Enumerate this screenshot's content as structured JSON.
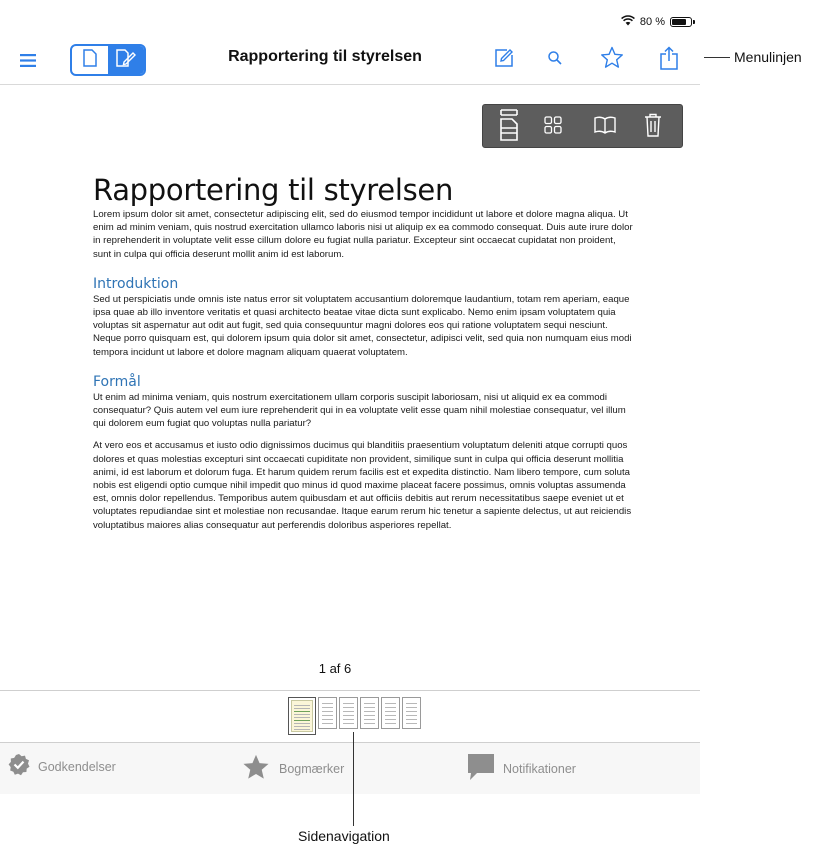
{
  "status_bar": {
    "battery": "80 %",
    "battery_level": 0.8
  },
  "menu_bar": {
    "title": "Rapportering til styrelsen",
    "icons": [
      "hamburger-menu-icon",
      "page-icon",
      "annotate-icon",
      "edit-icon",
      "search-icon",
      "star-icon",
      "share-icon"
    ],
    "accent_color": "#2f7fe8"
  },
  "callouts": {
    "menu": "Menulinjen",
    "page_nav": "Sidenavigation"
  },
  "doc_toolbar": {
    "icons": [
      "page-layout-icon",
      "grid-icon",
      "book-icon",
      "trash-icon"
    ]
  },
  "document": {
    "title": "Rapportering til styrelsen",
    "intro": "Lorem ipsum dolor sit amet, consectetur adipiscing elit, sed do eiusmod tempor incididunt ut labore et dolore magna aliqua. Ut enim ad minim veniam, quis nostrud exercitation ullamco laboris nisi ut aliquip ex ea commodo consequat. Duis aute irure dolor in reprehenderit in voluptate velit esse cillum dolore eu fugiat nulla pariatur. Excepteur sint occaecat cupidatat non proident, sunt in culpa qui officia deserunt mollit anim id est laborum.",
    "section1_heading": "Introduktion",
    "section1_body": "Sed ut perspiciatis unde omnis iste natus error sit voluptatem accusantium doloremque laudantium, totam rem aperiam, eaque ipsa quae ab illo inventore veritatis et quasi architecto beatae vitae dicta sunt explicabo. Nemo enim ipsam voluptatem quia voluptas sit aspernatur aut odit aut fugit, sed quia consequuntur magni dolores eos qui ratione voluptatem sequi nesciunt. Neque porro quisquam est, qui dolorem ipsum quia dolor sit amet, consectetur, adipisci velit, sed quia non numquam eius modi tempora incidunt ut labore et dolore magnam aliquam quaerat voluptatem.",
    "section2_heading": "Formål",
    "section2_body1": "Ut enim ad minima veniam, quis nostrum exercitationem ullam corporis suscipit laboriosam, nisi ut aliquid ex ea commodi consequatur? Quis autem vel eum iure reprehenderit qui in ea voluptate velit esse quam nihil molestiae consequatur, vel illum qui dolorem eum fugiat quo voluptas nulla pariatur?",
    "section2_body2": "At vero eos et accusamus et iusto odio dignissimos ducimus qui blanditiis praesentium voluptatum deleniti atque corrupti quos dolores et quas molestias excepturi sint occaecati cupiditate non provident, similique sunt in culpa qui officia deserunt mollitia animi, id est laborum et dolorum fuga. Et harum quidem rerum facilis est et expedita distinctio. Nam libero tempore, cum soluta nobis est eligendi optio cumque nihil impedit quo minus id quod maxime placeat facere possimus, omnis voluptas assumenda est, omnis dolor repellendus. Temporibus autem quibusdam et aut officiis debitis aut rerum necessitatibus saepe eveniet ut et voluptates repudiandae sint et molestiae non recusandae. Itaque earum rerum hic tenetur a sapiente delectus, ut aut reiciendis voluptatibus maiores alias consequatur aut perferendis doloribus asperiores repellat."
  },
  "page_indicator": "1 af 6",
  "thumbnails": {
    "count": 6,
    "current": 1
  },
  "tab_bar": {
    "tabs": [
      {
        "label": "Godkendelser",
        "icon": "badge-check-icon"
      },
      {
        "label": "Bogmærker",
        "icon": "star-filled-icon"
      },
      {
        "label": "Notifikationer",
        "icon": "chat-bubble-icon"
      }
    ]
  }
}
